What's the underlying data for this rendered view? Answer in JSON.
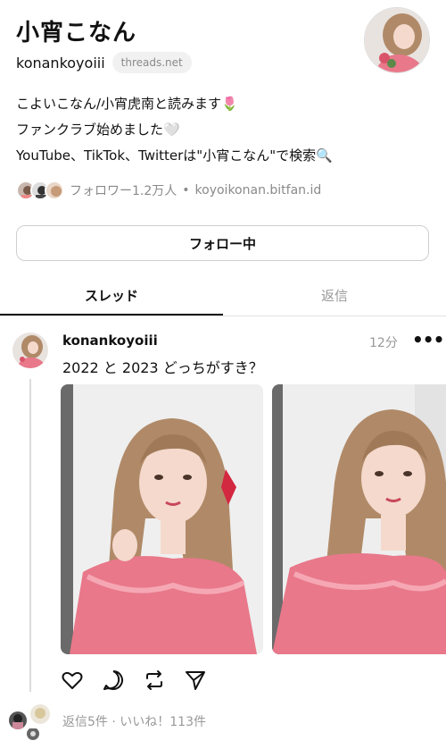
{
  "profile": {
    "name": "小宵こなん",
    "handle": "konankoyoiii",
    "domain_chip": "threads.net",
    "bio": [
      "こよいこなん/小宵虎南と読みます🌷",
      "ファンクラブ始めました🤍",
      "YouTube、TikTok、Twitterは\"小宵こなん\"で検索🔍"
    ],
    "followers": "フォロワー1.2万人",
    "separator": "•",
    "link": "koyoikonan.bitfan.id",
    "follow_button": "フォロー中"
  },
  "tabs": [
    {
      "label": "スレッド",
      "active": true
    },
    {
      "label": "返信",
      "active": false
    }
  ],
  "post": {
    "user": "konankoyoiii",
    "time": "12分",
    "more": "•••",
    "text": "2022 と 2023 どっちがすき？",
    "stats": "返信5件 · いいね！113件"
  },
  "colors": {
    "text": "#111111",
    "muted": "#999999",
    "border": "#cfcfcf",
    "dress_pink": "#e8788a",
    "hair": "#b08a68",
    "skin": "#f4d9cc"
  },
  "icons": [
    "heart-icon",
    "comment-icon",
    "repost-icon",
    "share-icon",
    "more-icon"
  ]
}
